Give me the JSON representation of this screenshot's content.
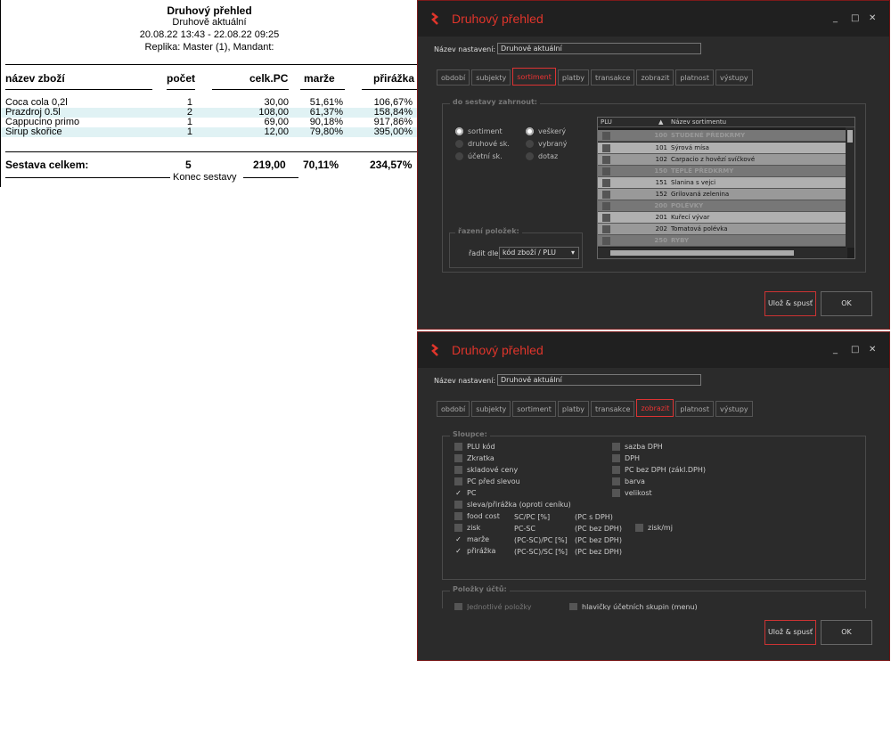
{
  "report": {
    "title": "Druhový přehled",
    "subtitle": "Druhově aktuální",
    "period": "20.08.22 13:43 - 22.08.22 09:25",
    "replica": "Replika: Master (1), Mandant:",
    "headers": [
      "název zboží",
      "počet",
      "celk.PC",
      "marže",
      "přirážka"
    ],
    "rows": [
      [
        "Coca cola 0,2l",
        "1",
        "30,00",
        "51,61%",
        "106,67%"
      ],
      [
        "Prazdroj 0.5l",
        "2",
        "108,00",
        "61,37%",
        "158,84%"
      ],
      [
        "Cappucino primo",
        "1",
        "69,00",
        "90,18%",
        "917,86%"
      ],
      [
        "Sirup skořice",
        "1",
        "12,00",
        "79,80%",
        "395,00%"
      ]
    ],
    "total": [
      "Sestava celkem:",
      "5",
      "219,00",
      "70,11%",
      "234,57%"
    ],
    "end": "Konec sestavy"
  },
  "windows": [
    {
      "title": "Druhový přehled",
      "controls": [
        "_",
        "□",
        "✕"
      ],
      "name_label": "Název nastavení:",
      "name_value": "Druhově aktuální",
      "tabs": [
        "období",
        "subjekty",
        "sortiment",
        "platby",
        "transakce",
        "zobrazit",
        "platnost",
        "výstupy"
      ],
      "active_tab": "sortiment",
      "include_legend": "do sestavy zahrnout:",
      "radios_left": [
        "sortiment",
        "druhové sk.",
        "účetní sk."
      ],
      "radios_right": [
        "veškerý",
        "vybraný",
        "dotaz"
      ],
      "grid_headers": [
        "PLU",
        "▲",
        "Název sortimentu"
      ],
      "grid_rows": [
        [
          "100",
          "STUDENÉ PŘEDKRMY"
        ],
        [
          "101",
          "Sýrová mísa"
        ],
        [
          "102",
          "Carpacio z hovězí svíčkové"
        ],
        [
          "150",
          "TEPLÉ PŘEDKRMY"
        ],
        [
          "151",
          "Slanina s vejci"
        ],
        [
          "152",
          "Grilovaná zelenina"
        ],
        [
          "200",
          "POLÉVKY"
        ],
        [
          "201",
          "Kuřecí vývar"
        ],
        [
          "202",
          "Tomatová polévka"
        ],
        [
          "250",
          "RYBY"
        ]
      ],
      "sort_legend": "řazení položek:",
      "sort_label": "řadit dle:",
      "sort_value": "kód zboží / PLU",
      "btn_save": "Ulož & spusť",
      "btn_ok": "OK"
    },
    {
      "title": "Druhový přehled",
      "controls": [
        "_",
        "□",
        "✕"
      ],
      "name_label": "Název nastavení:",
      "name_value": "Druhově aktuální",
      "tabs": [
        "období",
        "subjekty",
        "sortiment",
        "platby",
        "transakce",
        "zobrazit",
        "platnost",
        "výstupy"
      ],
      "active_tab": "zobrazit",
      "columns_legend": "Sloupce:",
      "cols_left": [
        {
          "label": "PLU kód",
          "checked": false
        },
        {
          "label": "Zkratka",
          "checked": false
        },
        {
          "label": "skladové ceny",
          "checked": false
        },
        {
          "label": "PC před slevou",
          "checked": false
        },
        {
          "label": "PC",
          "checked": true
        },
        {
          "label": "sleva/přirážka (oproti ceníku)",
          "checked": false
        },
        {
          "label": "food cost",
          "checked": false
        },
        {
          "label": "zisk",
          "checked": false
        },
        {
          "label": "marže",
          "checked": true
        },
        {
          "label": "přirážka",
          "checked": true
        }
      ],
      "formulas": [
        [
          "SC/PC [%]",
          "(PC s DPH)"
        ],
        [
          "PC-SC",
          "(PC bez DPH)"
        ],
        [
          "(PC-SC)/PC [%]",
          "(PC bez DPH)"
        ],
        [
          "(PC-SC)/SC [%]",
          "(PC bez DPH)"
        ]
      ],
      "profit_label": "zisk/mj",
      "cols_right": [
        {
          "label": "sazba DPH",
          "checked": false
        },
        {
          "label": "DPH",
          "checked": false
        },
        {
          "label": "PC bez DPH (zákl.DPH)",
          "checked": false
        },
        {
          "label": "barva",
          "checked": false
        },
        {
          "label": "velikost",
          "checked": false
        }
      ],
      "items_legend": "Položky účtů:",
      "items_partial_left": "Jednotlivé položky",
      "items_partial_right": "hlavičky účetních skupin (menu)",
      "btn_save": "Ulož & spusť",
      "btn_ok": "OK"
    }
  ]
}
